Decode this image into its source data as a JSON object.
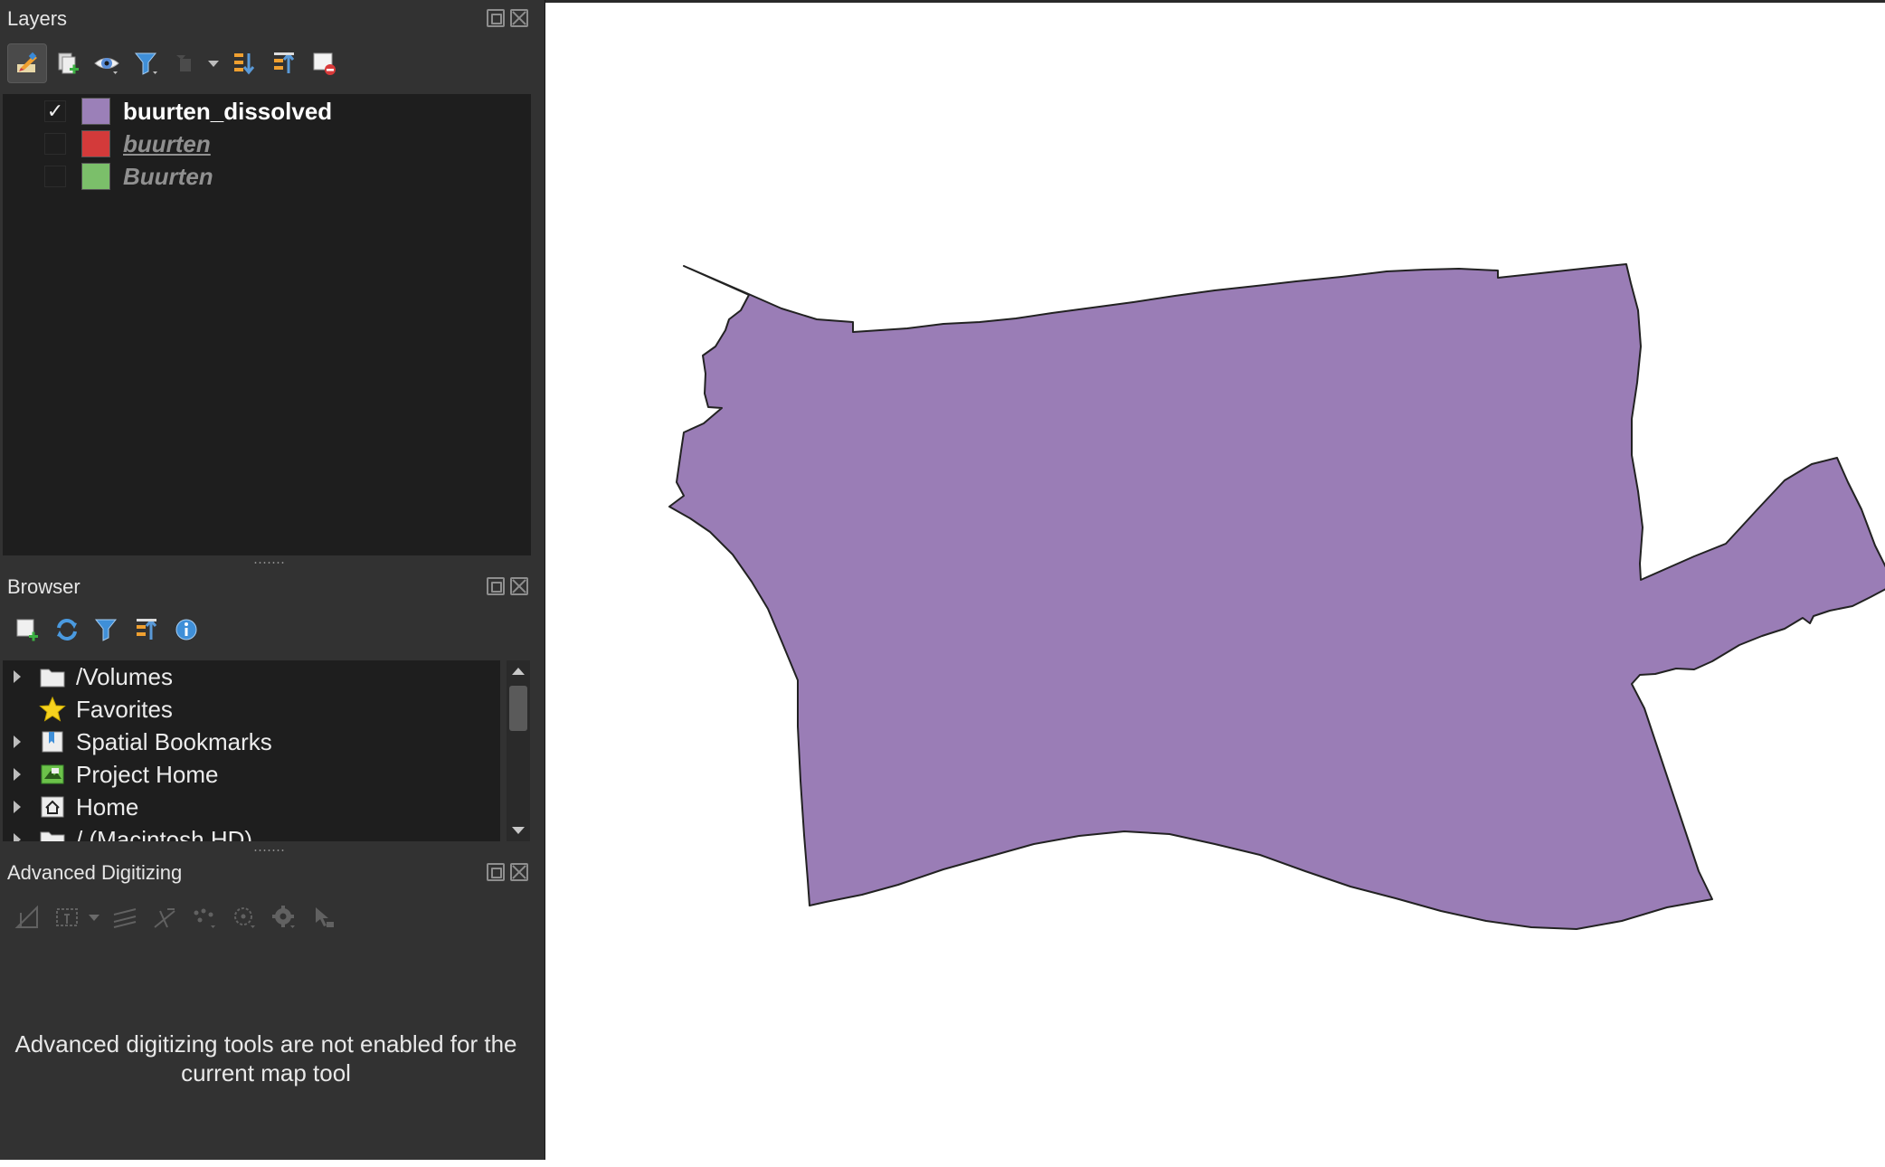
{
  "layers_panel": {
    "title": "Layers",
    "toolbar_icons": [
      "style-brush-icon",
      "add-group-icon",
      "eye-icon",
      "filter-icon",
      "filter-legend-icon",
      "expand-all-icon",
      "collapse-all-icon",
      "remove-layer-icon"
    ],
    "layers": [
      {
        "name": "buurten_dissolved",
        "checked": true,
        "color": "#9b80b8",
        "checkmark": "✓"
      },
      {
        "name": "buurten",
        "checked": false,
        "color": "#d33a3a"
      },
      {
        "name": "Buurten",
        "checked": false,
        "color": "#7bbf6a"
      }
    ]
  },
  "browser_panel": {
    "title": "Browser",
    "toolbar_icons": [
      "add-selected-icon",
      "refresh-icon",
      "filter-icon",
      "collapse-all-icon",
      "info-icon"
    ],
    "items": [
      {
        "label": "/Volumes",
        "icon": "folder-icon",
        "expandable": true
      },
      {
        "label": "Favorites",
        "icon": "star-icon",
        "expandable": false
      },
      {
        "label": "Spatial Bookmarks",
        "icon": "bookmark-icon",
        "expandable": true
      },
      {
        "label": "Project Home",
        "icon": "project-home-icon",
        "expandable": true
      },
      {
        "label": "Home",
        "icon": "home-icon",
        "expandable": true
      },
      {
        "label": "/ (Macintosh HD)",
        "icon": "folder-icon",
        "expandable": true
      }
    ]
  },
  "digitizing_panel": {
    "title": "Advanced Digitizing",
    "message": "Advanced digitizing tools are not enabled for the current map tool"
  },
  "map": {
    "polygon_fill": "#9a7db6",
    "polygon_stroke": "#222222"
  }
}
